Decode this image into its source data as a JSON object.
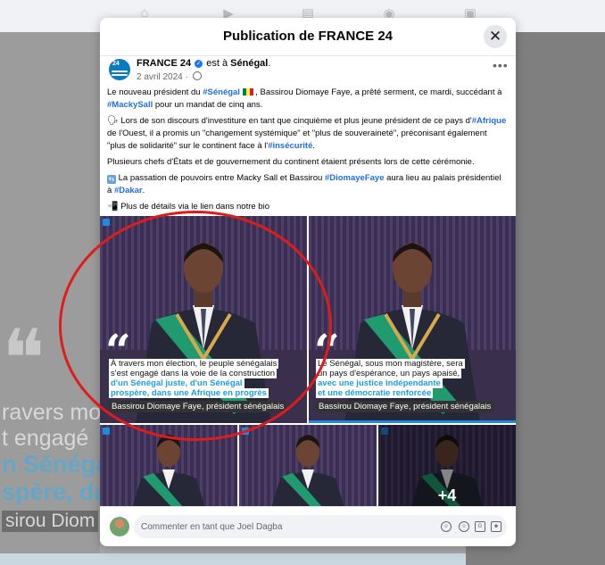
{
  "modal": {
    "title": "Publication de FRANCE 24",
    "close_symbol": "✕"
  },
  "post": {
    "author": "FRANCE 24",
    "is_in": " est à ",
    "location": "Sénégal",
    "location_suffix": ".",
    "date": "2 avril 2024",
    "date_sep": " · ",
    "more_symbol": "•••",
    "paragraphs": {
      "p1": {
        "a": "Le nouveau président du ",
        "tag1": "#Sénégal",
        "b": " , Bassirou Diomaye Faye, a prêté serment, ce mardi, succédant à ",
        "tag2": "#MackySall",
        "c": " pour un mandat de cinq ans."
      },
      "p2": {
        "a": " Lors de son discours d'investiture en tant que cinquième et plus jeune président de ce pays d'",
        "tag1": "#Afrique",
        "b": " de l'Ouest, il a promis un \"changement systémique\" et \"plus de souveraineté\", préconisant également \"plus de solidarité\" sur le continent face à l'",
        "tag2": "#insécurité",
        "c": "."
      },
      "p3": {
        "a": "Plusieurs chefs d'États et de gouvernement du continent étaient présents lors de cette cérémonie."
      },
      "p4": {
        "a": " La passation de pouvoirs entre Macky Sall et Bassirou ",
        "tag1": "#DiomayeFaye",
        "b": " aura lieu au palais présidentiel à ",
        "tag2": "#Dakar",
        "c": "."
      },
      "p5": {
        "a": " Plus de détails via le lien dans notre bio"
      }
    }
  },
  "photos": {
    "p1": {
      "line1": "À travers mon élection, le peuple sénégalais",
      "line2": "s'est engagé dans la voie de la construction",
      "line3": "d'un Sénégal juste, d'un Sénégal",
      "line4": "prospère, dans une Afrique en progrès",
      "signature": "Bassirou Diomaye Faye, président sénégalais"
    },
    "p2": {
      "line1": "Le Sénégal, sous mon magistère, sera",
      "line2": "un pays d'espérance, un pays apaisé,",
      "line3": "avec une justice indépendante",
      "line4": "et une démocratie renforcée",
      "signature": "Bassirou Diomaye Faye, président sénégalais"
    },
    "more_count": "+4"
  },
  "background": {
    "l1": "ravers mo",
    "l2": "t engagé",
    "l3": "n Sénéga",
    "l4": "spère, da",
    "l5": "sirou Diom"
  },
  "comment": {
    "placeholder": "Commenter en tant que Joel Dagba"
  },
  "colors": {
    "hashtag": "#216fdb",
    "quote_highlight": "#1c9ee0",
    "annotation": "#e01b1b"
  }
}
